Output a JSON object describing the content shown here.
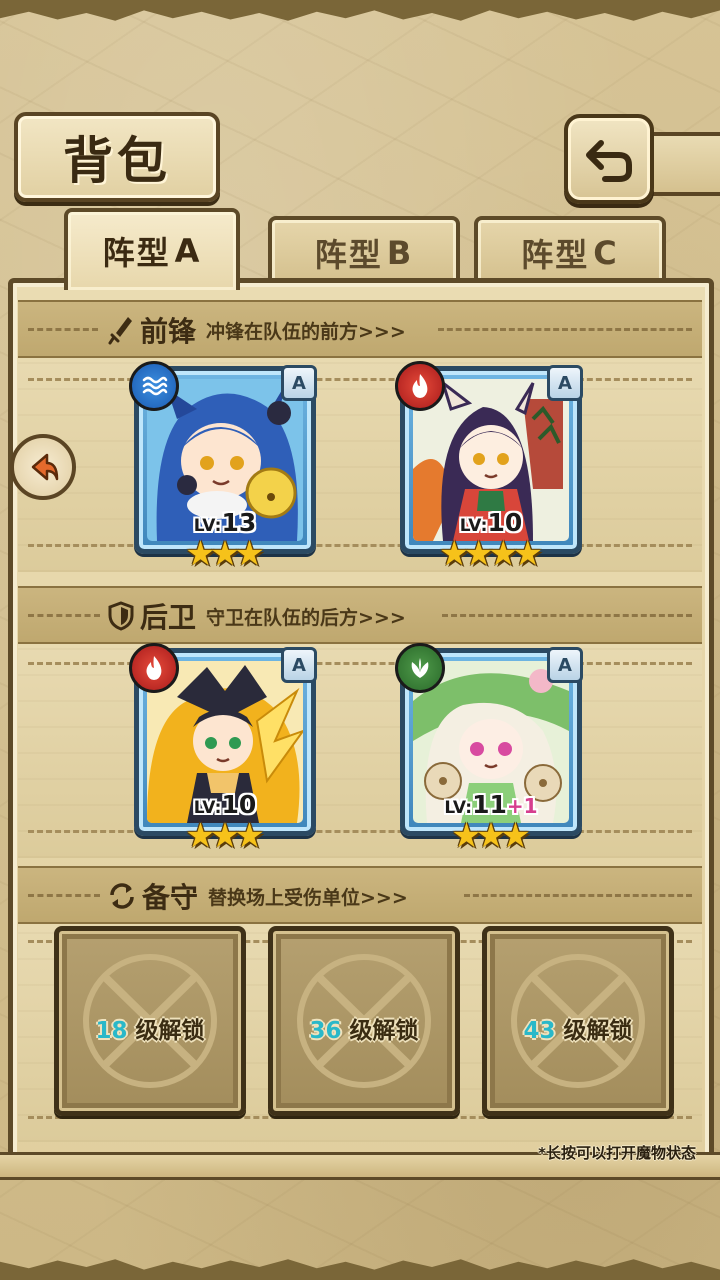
{
  "header": {
    "title": "背包"
  },
  "tabs": [
    {
      "label": "阵型",
      "letter": "A",
      "active": true
    },
    {
      "label": "阵型",
      "letter": "B",
      "active": false
    },
    {
      "label": "阵型",
      "letter": "C",
      "active": false
    }
  ],
  "sections": {
    "front": {
      "title": "前锋",
      "subtitle": "冲锋在队伍的前方>>>"
    },
    "rear": {
      "title": "后卫",
      "subtitle": "守卫在队伍的后方>>>"
    },
    "reserve": {
      "title": "备守",
      "subtitle": "替换场上受伤单位>>>"
    }
  },
  "front_units": [
    {
      "element": "water-icon",
      "rank": "A",
      "lv_prefix": "LV:",
      "level": "13",
      "plus": "",
      "stars": 3,
      "colors": {
        "main": "#2f5fb8",
        "accent": "#f3d24a"
      }
    },
    {
      "element": "fire-icon",
      "rank": "A",
      "lv_prefix": "LV:",
      "level": "10",
      "plus": "",
      "stars": 4,
      "colors": {
        "main": "#3a2a55",
        "accent": "#d8463a"
      }
    }
  ],
  "rear_units": [
    {
      "element": "fire-icon",
      "rank": "A",
      "lv_prefix": "LV:",
      "level": "10",
      "plus": "",
      "stars": 3,
      "colors": {
        "main": "#f2b21d",
        "accent": "#2a2a3a"
      }
    },
    {
      "element": "leaf-icon",
      "rank": "A",
      "lv_prefix": "LV:",
      "level": "11",
      "plus": "+1",
      "stars": 3,
      "colors": {
        "main": "#f4efe2",
        "accent": "#7dbf6a"
      }
    }
  ],
  "reserve_slots": [
    {
      "level": "18",
      "text": "级解锁"
    },
    {
      "level": "36",
      "text": "级解锁"
    },
    {
      "level": "43",
      "text": "级解锁"
    }
  ],
  "hint": "*长按可以打开魔物状态",
  "colors": {
    "tab_letter_active": "#e88a18",
    "unlock_number": "#2ab8c9",
    "plus_level": "#d63e8e",
    "star": "#f6c21a"
  }
}
